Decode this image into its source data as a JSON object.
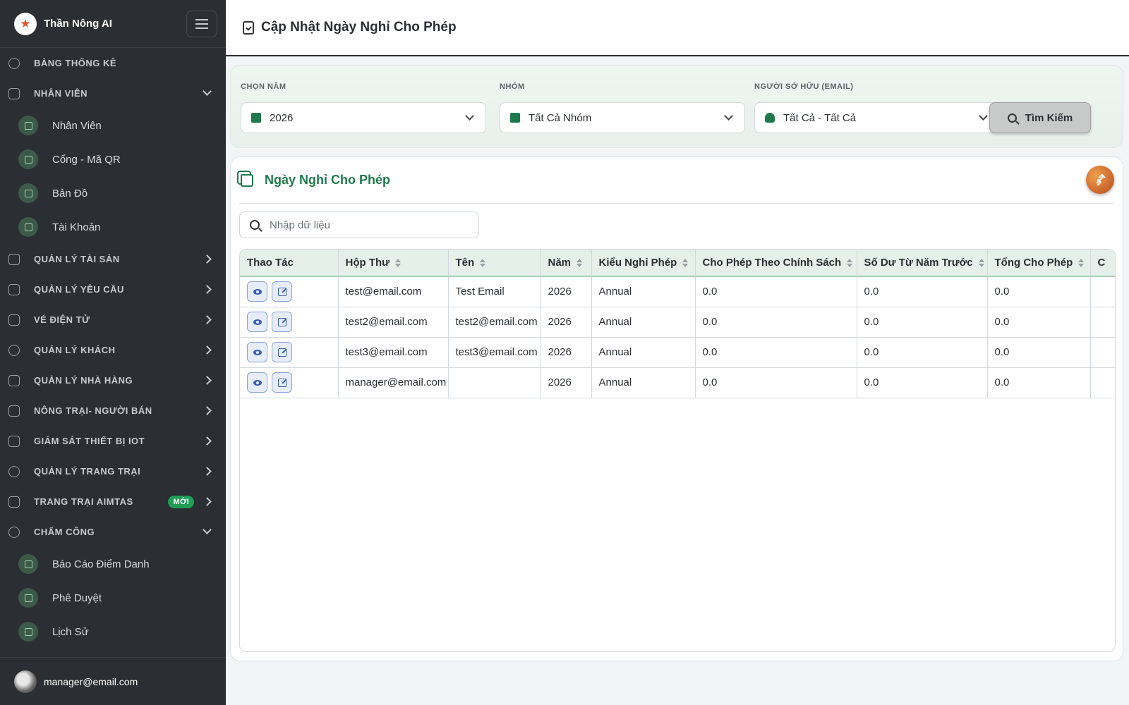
{
  "app": {
    "name": "Thần Nông AI",
    "logo_icon": "star-logo-icon"
  },
  "sidebar": {
    "sections": [
      {
        "label": "BẢNG THỐNG KÊ",
        "icon": "dashboard-icon",
        "expanded": null
      },
      {
        "label": "NHÂN VIÊN",
        "icon": "people-icon",
        "expanded": true,
        "items": [
          {
            "label": "Nhân Viên",
            "icon": "people-icon"
          },
          {
            "label": "Cổng - Mã QR",
            "icon": "qrcode-icon"
          },
          {
            "label": "Bản Đồ",
            "icon": "map-icon"
          },
          {
            "label": "Tài Khoản",
            "icon": "id-card-icon"
          }
        ]
      },
      {
        "label": "QUẢN LÝ TÀI SẢN",
        "icon": "sitemap-icon",
        "expanded": false
      },
      {
        "label": "QUẢN LÝ YÊU CẦU",
        "icon": "clipboard-icon",
        "expanded": false
      },
      {
        "label": "VÉ ĐIỆN TỬ",
        "icon": "ticket-icon",
        "expanded": false
      },
      {
        "label": "QUẢN LÝ KHÁCH",
        "icon": "users-icon",
        "expanded": false
      },
      {
        "label": "QUẢN LÝ NHÀ HÀNG",
        "icon": "utensils-icon",
        "expanded": false
      },
      {
        "label": "NÔNG TRẠI- NGƯỜI BÁN",
        "icon": "store-icon",
        "expanded": false
      },
      {
        "label": "GIÁM SÁT THIẾT BỊ IOT",
        "icon": "chart-icon",
        "expanded": false
      },
      {
        "label": "QUẢN LÝ TRANG TRẠI",
        "icon": "tractor-icon",
        "expanded": false
      },
      {
        "label": "TRANG TRẠI AIMTAS",
        "icon": "handshake-icon",
        "expanded": false,
        "badge": "MỚI"
      },
      {
        "label": "CHẤM CÔNG",
        "icon": "clock-icon",
        "expanded": true,
        "items": [
          {
            "label": "Báo Cáo Điểm Danh",
            "icon": "bar-chart-icon"
          },
          {
            "label": "Phê Duyệt",
            "icon": "thumbs-up-icon"
          },
          {
            "label": "Lịch Sử",
            "icon": "history-icon"
          }
        ]
      }
    ],
    "user": {
      "email": "manager@email.com"
    }
  },
  "header": {
    "title": "Cập Nhật Ngày Nghỉ Cho Phép"
  },
  "filters": {
    "year": {
      "label": "CHỌN NĂM",
      "value": "2026"
    },
    "group": {
      "label": "NHÓM",
      "value": "Tất Cả Nhóm"
    },
    "owner": {
      "label": "NGƯỜI SỞ HỮU (EMAIL)",
      "value": "Tất Cả - Tất Cả"
    },
    "search_button": "Tìm Kiếm"
  },
  "card": {
    "title": "Ngày Nghỉ Cho Phép",
    "search_placeholder": "Nhập dữ liệu"
  },
  "table": {
    "columns": [
      "Thao Tác",
      "Hộp Thư",
      "Tên",
      "Năm",
      "Kiểu Nghỉ Phép",
      "Cho Phép Theo Chính Sách",
      "Số Dư Từ Năm Trước",
      "Tổng Cho Phép",
      "C"
    ],
    "rows": [
      {
        "email": "test@email.com",
        "name": "Test Email",
        "year": "2026",
        "type": "Annual",
        "policy": "0.0",
        "carry": "0.0",
        "total": "0.0"
      },
      {
        "email": "test2@email.com",
        "name": "test2@email.com",
        "year": "2026",
        "type": "Annual",
        "policy": "0.0",
        "carry": "0.0",
        "total": "0.0"
      },
      {
        "email": "test3@email.com",
        "name": "test3@email.com",
        "year": "2026",
        "type": "Annual",
        "policy": "0.0",
        "carry": "0.0",
        "total": "0.0"
      },
      {
        "email": "manager@email.com",
        "name": "",
        "year": "2026",
        "type": "Annual",
        "policy": "0.0",
        "carry": "0.0",
        "total": "0.0"
      }
    ]
  },
  "colors": {
    "sidebar_bg": "#2b2e33",
    "accent_green": "#1e7a4c",
    "badge_green": "#1f9d55",
    "header_row": "#e4f0e9"
  }
}
